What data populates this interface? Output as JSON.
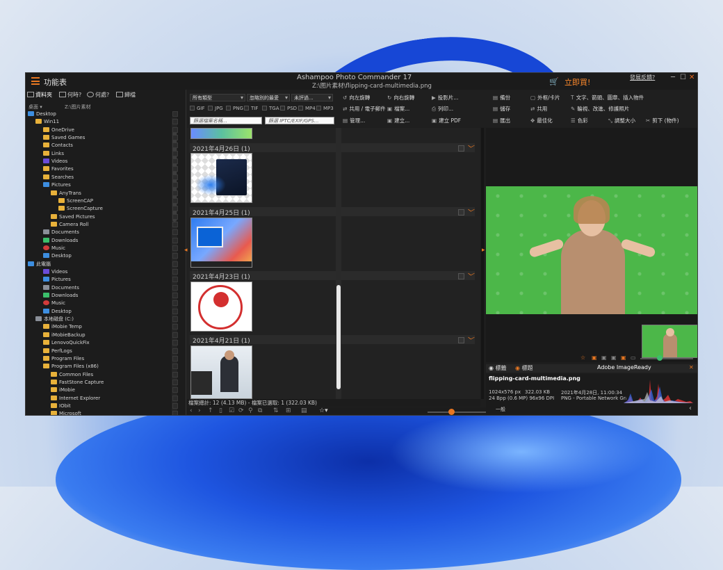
{
  "window": {
    "menu_label": "功能表",
    "app_title": "Ashampoo Photo Commander 17",
    "file_path": "Z:\\图片素材\\flipping-card-multimedia.png",
    "cart_icon": "cart-icon",
    "buy_label": "立即買!",
    "feedback_label": "發展反饋?",
    "accent_color": "#e87722"
  },
  "left_panel": {
    "tabs": [
      {
        "label": "資料夾",
        "icon": "folder-icon"
      },
      {
        "label": "何時?",
        "icon": "calendar-icon"
      },
      {
        "label": "何處?",
        "icon": "globe-icon"
      },
      {
        "label": "歸檔",
        "icon": "archive-icon"
      }
    ],
    "path_prefix": "桌面",
    "path": "Z:\\图片素材",
    "tree": [
      {
        "label": "Desktop",
        "depth": 0,
        "icon": "blue"
      },
      {
        "label": "Win11",
        "depth": 1,
        "icon": "folder"
      },
      {
        "label": "OneDrive",
        "depth": 2,
        "icon": "folder"
      },
      {
        "label": "Saved Games",
        "depth": 2,
        "icon": "folder"
      },
      {
        "label": "Contacts",
        "depth": 2,
        "icon": "folder"
      },
      {
        "label": "Links",
        "depth": 2,
        "icon": "folder"
      },
      {
        "label": "Videos",
        "depth": 2,
        "icon": "purple"
      },
      {
        "label": "Favorites",
        "depth": 2,
        "icon": "folder"
      },
      {
        "label": "Searches",
        "depth": 2,
        "icon": "folder"
      },
      {
        "label": "Pictures",
        "depth": 2,
        "icon": "blue"
      },
      {
        "label": "AnyTrans",
        "depth": 3,
        "icon": "folder"
      },
      {
        "label": "ScreenCAP",
        "depth": 4,
        "icon": "folder"
      },
      {
        "label": "ScreenCapture",
        "depth": 4,
        "icon": "folder"
      },
      {
        "label": "Saved Pictures",
        "depth": 3,
        "icon": "folder"
      },
      {
        "label": "Camera Roll",
        "depth": 3,
        "icon": "folder"
      },
      {
        "label": "Documents",
        "depth": 2,
        "icon": "gray"
      },
      {
        "label": "Downloads",
        "depth": 2,
        "icon": "green"
      },
      {
        "label": "Music",
        "depth": 2,
        "icon": "red"
      },
      {
        "label": "Desktop",
        "depth": 2,
        "icon": "blue"
      },
      {
        "label": "此電腦",
        "depth": 0,
        "icon": "blue"
      },
      {
        "label": "Videos",
        "depth": 2,
        "icon": "purple"
      },
      {
        "label": "Pictures",
        "depth": 2,
        "icon": "blue"
      },
      {
        "label": "Documents",
        "depth": 2,
        "icon": "gray"
      },
      {
        "label": "Downloads",
        "depth": 2,
        "icon": "green"
      },
      {
        "label": "Music",
        "depth": 2,
        "icon": "red"
      },
      {
        "label": "Desktop",
        "depth": 2,
        "icon": "blue"
      },
      {
        "label": "本地磁盘 (C:)",
        "depth": 1,
        "icon": "gray"
      },
      {
        "label": "iMobie Temp",
        "depth": 2,
        "icon": "folder"
      },
      {
        "label": "iMobieBackup",
        "depth": 2,
        "icon": "folder"
      },
      {
        "label": "LenovoQuickFix",
        "depth": 2,
        "icon": "folder"
      },
      {
        "label": "PerfLogs",
        "depth": 2,
        "icon": "folder"
      },
      {
        "label": "Program Files",
        "depth": 2,
        "icon": "folder"
      },
      {
        "label": "Program Files (x86)",
        "depth": 2,
        "icon": "folder"
      },
      {
        "label": "Common Files",
        "depth": 3,
        "icon": "folder"
      },
      {
        "label": "FastStone Capture",
        "depth": 3,
        "icon": "folder"
      },
      {
        "label": "iMobie",
        "depth": 3,
        "icon": "folder"
      },
      {
        "label": "Internet Explorer",
        "depth": 3,
        "icon": "folder"
      },
      {
        "label": "IObit",
        "depth": 3,
        "icon": "folder"
      },
      {
        "label": "Microsoft",
        "depth": 3,
        "icon": "folder"
      }
    ]
  },
  "toolbar": {
    "type_select": "所有類型",
    "sort_select": "忽略別的最愛",
    "rating_select": "未評過...",
    "file_types": [
      "GIF",
      "JPG",
      "PNG",
      "TIF",
      "TGA",
      "PSD",
      "MP4",
      "MP3"
    ],
    "name_search_placeholder": "篩選檔案名稱...",
    "meta_search_placeholder": "篩選 IPTC/EXIF/GPS...",
    "actions": [
      {
        "label": "向左旋轉",
        "icon": "rotate-left-icon"
      },
      {
        "label": "向右旋轉",
        "icon": "rotate-right-icon"
      },
      {
        "label": "投影片...",
        "icon": "slideshow-icon"
      },
      {
        "label": "備份",
        "icon": "backup-icon"
      },
      {
        "label": "外框/卡片",
        "icon": "frame-icon"
      },
      {
        "label": "文字、箭頭、圖章、插入物件",
        "icon": "text-icon"
      },
      {
        "label": "共用 / 電子郵件",
        "icon": "share-icon"
      },
      {
        "label": "檔案...",
        "icon": "file-icon"
      },
      {
        "label": "列印...",
        "icon": "print-icon"
      },
      {
        "label": "儲存",
        "icon": "save-icon"
      },
      {
        "label": "共用",
        "icon": "share-icon"
      },
      {
        "label": "輪視、改進、修護照片",
        "icon": "brush-icon"
      },
      {
        "label": "管理...",
        "icon": "manage-icon"
      },
      {
        "label": "建立...",
        "icon": "create-icon"
      },
      {
        "label": "建立 PDF",
        "icon": "pdf-icon"
      },
      {
        "label": "匯出",
        "icon": "export-icon"
      },
      {
        "label": "最佳化",
        "icon": "optimize-icon"
      },
      {
        "label": "色彩",
        "icon": "color-icon"
      },
      {
        "label": "調整大小",
        "icon": "resize-icon"
      },
      {
        "label": "剪下 (物件)",
        "icon": "cut-icon"
      }
    ]
  },
  "thumbnails": {
    "groups": [
      {
        "date": "2021年4月26日 (1)"
      },
      {
        "date": "2021年4月25日 (1)"
      },
      {
        "date": "2021年4月23日 (1)"
      },
      {
        "date": "2021年4月21日 (1)"
      }
    ],
    "status": "檔案總計: 12 (4.13 MB) - 檔案已選取: 1 (322.03 KB)",
    "zoom_level": 0.3
  },
  "info_panel": {
    "tab_left": "標籤",
    "tab_right": "標題",
    "software": "Adobe ImageReady",
    "file_name": "flipping-card-multimedia.png",
    "dimensions": "1024x576 px",
    "file_size": "322.03 KB",
    "date": "2021年4月28日, 11:00:34",
    "color_info": "24 Bpp (0.6 MP) 96x96 DPI",
    "format": "PNG - Portable Network Graphics",
    "category": "一般"
  }
}
